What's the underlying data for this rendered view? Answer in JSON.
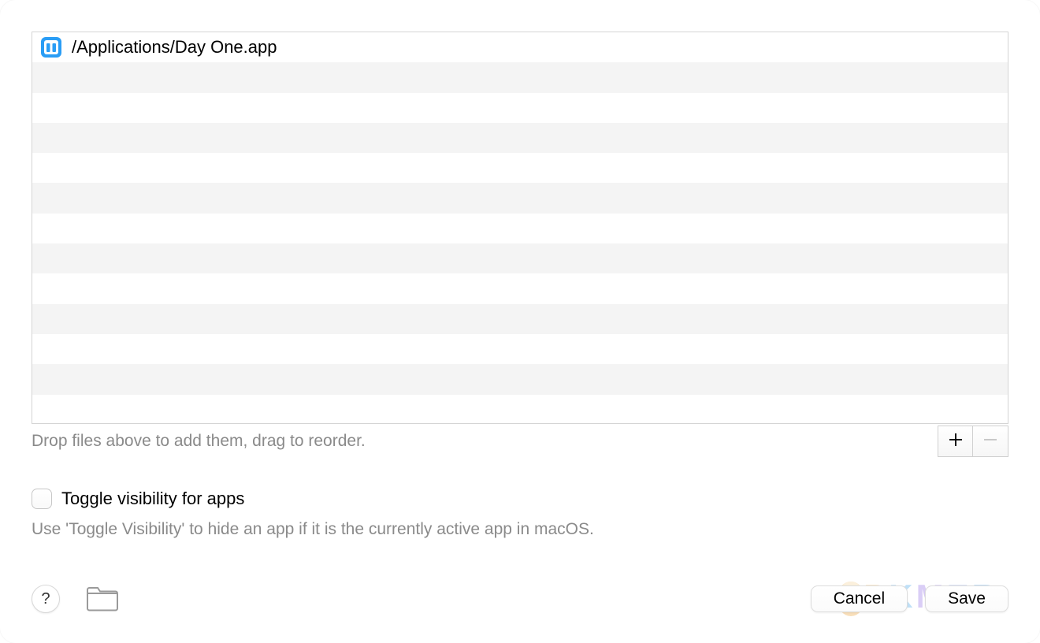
{
  "file_list": {
    "items": [
      {
        "path": "/Applications/Day One.app",
        "icon": "day-one-app-icon"
      }
    ],
    "hint": "Drop files above to add them, drag to reorder."
  },
  "controls": {
    "add_label": "+",
    "remove_label": "−"
  },
  "toggle": {
    "label": "Toggle visibility for apps",
    "description": "Use 'Toggle Visibility' to hide an app if it is the currently active app in macOS."
  },
  "footer": {
    "help_label": "?",
    "cancel_label": "Cancel",
    "save_label": "Save"
  },
  "watermark": {
    "text": "PKMER"
  }
}
